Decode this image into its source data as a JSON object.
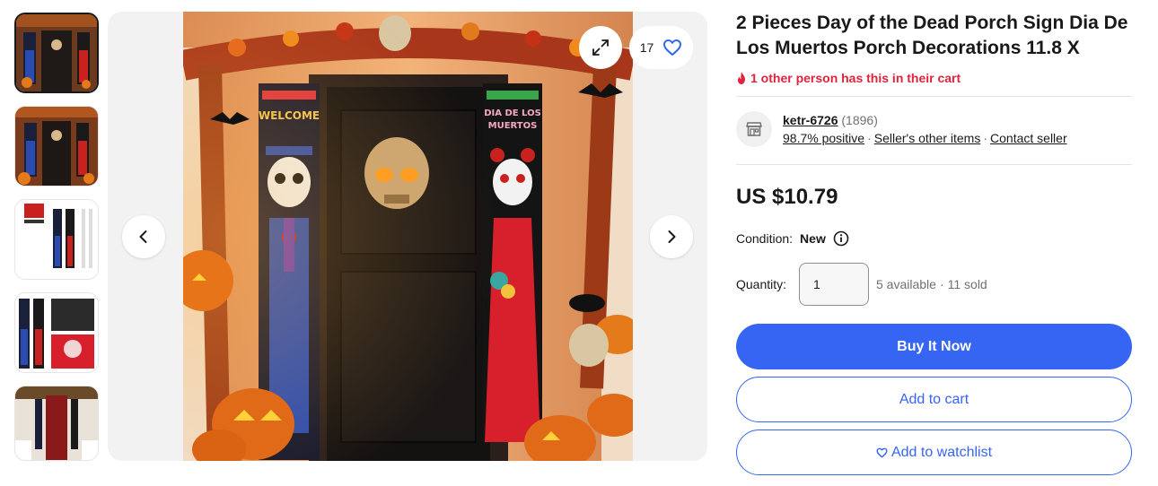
{
  "gallery": {
    "thumbnails": [
      "thumb-1",
      "thumb-2",
      "thumb-3",
      "thumb-4",
      "thumb-5"
    ],
    "active_index": 0,
    "watch_count": "17"
  },
  "listing": {
    "title": "2 Pieces Day of the Dead Porch Sign Dia De Los Muertos Porch Decorations 11.8 X",
    "cart_alert": "1 other person has this in their cart",
    "seller": {
      "name": "ketr-6726",
      "feedback_count": "(1896)",
      "positive": "98.7% positive",
      "other_items": "Seller's other items",
      "contact": "Contact seller"
    },
    "price": "US $10.79",
    "condition_label": "Condition:",
    "condition_value": "New",
    "quantity_label": "Quantity:",
    "quantity_value": "1",
    "available": "5 available",
    "sold": "11 sold",
    "buttons": {
      "buy_now": "Buy It Now",
      "add_to_cart": "Add to cart",
      "watchlist": "Add to watchlist"
    }
  },
  "banner_text": {
    "left": "WELCOME",
    "right_line1": "DIA DE LOS",
    "right_line2": "MUERTOS"
  },
  "colors": {
    "accent": "#3665f3",
    "alert": "#e0233c",
    "text": "#191919",
    "muted": "#707070"
  },
  "icons": [
    "chevron-left-icon",
    "chevron-right-icon",
    "expand-icon",
    "heart-icon",
    "fire-icon",
    "store-icon",
    "info-icon"
  ]
}
